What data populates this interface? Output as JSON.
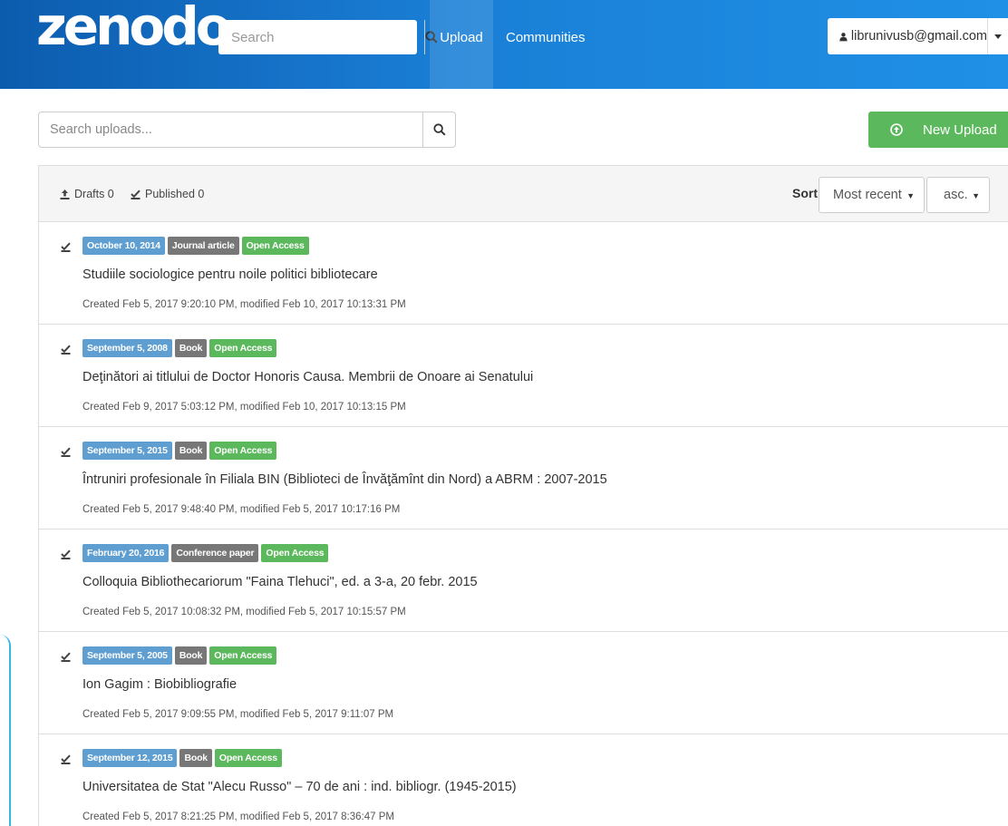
{
  "header": {
    "logo": "zenodo",
    "search_placeholder": "Search",
    "nav_upload": "Upload",
    "nav_communities": "Communities",
    "user_email": "librunivusb@gmail.com"
  },
  "toolbar": {
    "search_placeholder": "Search uploads...",
    "new_upload_label": "New Upload"
  },
  "filters": {
    "drafts": "Drafts 0",
    "published": "Published 0",
    "sort_label": "Sort",
    "sort_selected": "Most recent",
    "order_selected": "asc."
  },
  "records": [
    {
      "date": "October 10, 2014",
      "type": "Journal article",
      "access": "Open Access",
      "title": "Studiile sociologice pentru noile politici bibliotecare",
      "meta": "Created Feb 5, 2017 9:20:10 PM, modified Feb 10, 2017 10:13:31 PM"
    },
    {
      "date": "September 5, 2008",
      "type": "Book",
      "access": "Open Access",
      "title": "Deţinători ai titlului de Doctor Honoris Causa. Membrii de Onoare ai Senatului",
      "meta": "Created Feb 9, 2017 5:03:12 PM, modified Feb 10, 2017 10:13:15 PM"
    },
    {
      "date": "September 5, 2015",
      "type": "Book",
      "access": "Open Access",
      "title": "Întruniri profesionale în Filiala BIN (Biblioteci de Învăţămînt din Nord) a ABRM : 2007-2015",
      "meta": "Created Feb 5, 2017 9:48:40 PM, modified Feb 5, 2017 10:17:16 PM"
    },
    {
      "date": "February 20, 2016",
      "type": "Conference paper",
      "access": "Open Access",
      "title": "Colloquia Bibliothecariorum \"Faina Tlehuci\", ed. a 3-a, 20 febr. 2015",
      "meta": "Created Feb 5, 2017 10:08:32 PM, modified Feb 5, 2017 10:15:57 PM"
    },
    {
      "date": "September 5, 2005",
      "type": "Book",
      "access": "Open Access",
      "title": "Ion Gagim : Biobibliografie",
      "meta": "Created Feb 5, 2017 9:09:55 PM, modified Feb 5, 2017 9:11:07 PM"
    },
    {
      "date": "September 12, 2015",
      "type": "Book",
      "access": "Open Access",
      "title": "Universitatea de Stat \"Alecu Russo\" – 70 de ani : ind. bibliogr. (1945-2015)",
      "meta": "Created Feb 5, 2017 8:21:25 PM, modified Feb 5, 2017 8:36:47 PM"
    }
  ],
  "colors": {
    "header_dark": "#0c5cae",
    "header_light": "#1f90e6",
    "success": "#5cb85c",
    "badge_date": "#5f9ed1",
    "badge_type": "#777777"
  },
  "icons": {
    "search": "magnifier-icon",
    "user": "user-icon",
    "caret": "caret-down-icon",
    "upload": "upload-circle-icon",
    "drafts": "upload-tray-icon",
    "published": "check-icon"
  }
}
